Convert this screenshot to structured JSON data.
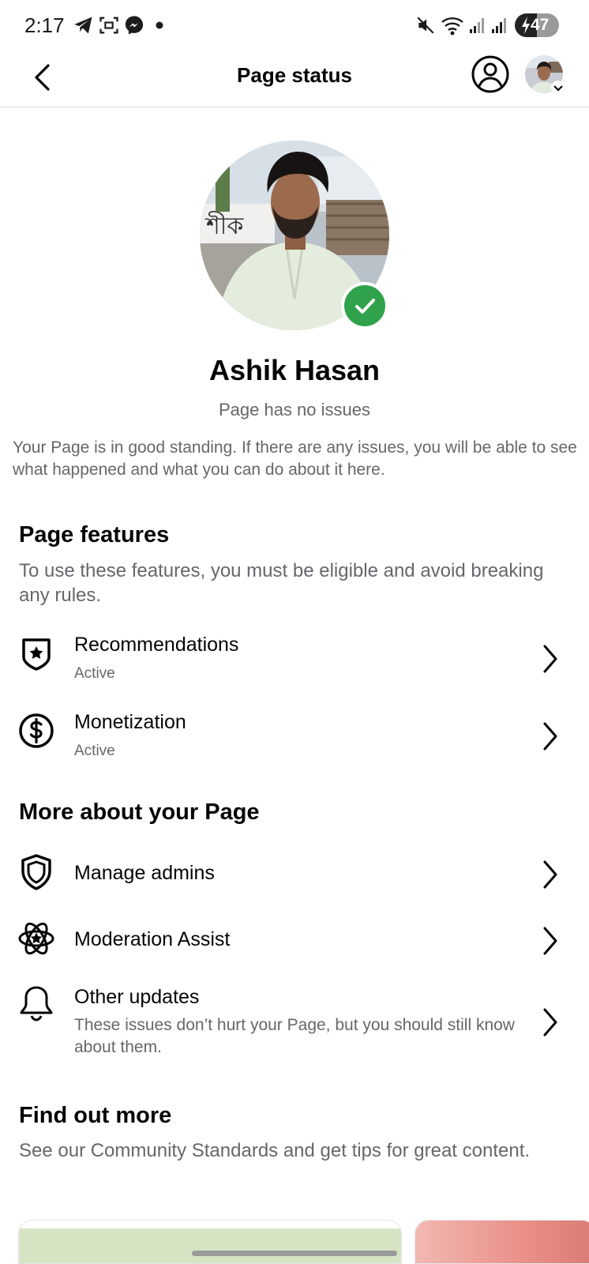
{
  "status_bar": {
    "time": "2:17",
    "battery": "47",
    "icons": [
      "telegram-icon",
      "screenshot-icon",
      "messenger-icon",
      "dot-icon",
      "mute-icon",
      "wifi-icon",
      "signal-icon",
      "signal-icon",
      "battery-charging-icon"
    ]
  },
  "header": {
    "title": "Page status",
    "back_icon": "chevron-left-icon",
    "profile_icon": "user-circle-icon"
  },
  "profile": {
    "name": "Ashik Hasan",
    "status": "Page has no issues",
    "standing_text": "Your Page is in good standing. If there are any issues, you will be able to see what happened and what you can do about it here.",
    "badge_icon": "checkmark-icon"
  },
  "features": {
    "title": "Page features",
    "description": "To use these features, you must be eligible and avoid breaking any rules.",
    "items": [
      {
        "icon": "shield-star-icon",
        "label": "Recommendations",
        "status": "Active"
      },
      {
        "icon": "dollar-circle-icon",
        "label": "Monetization",
        "status": "Active"
      }
    ]
  },
  "more": {
    "title": "More about your Page",
    "items": [
      {
        "icon": "shield-icon",
        "label": "Manage admins"
      },
      {
        "icon": "atom-star-icon",
        "label": "Moderation Assist"
      },
      {
        "icon": "bell-icon",
        "label": "Other updates",
        "description": "These issues don’t hurt your Page, but you should still know about them."
      }
    ]
  },
  "find_out": {
    "title": "Find out more",
    "description": "See our Community Standards and get tips for great content."
  },
  "colors": {
    "accent_green": "#31a24c",
    "text_primary": "#050505",
    "text_secondary": "#65676b"
  }
}
